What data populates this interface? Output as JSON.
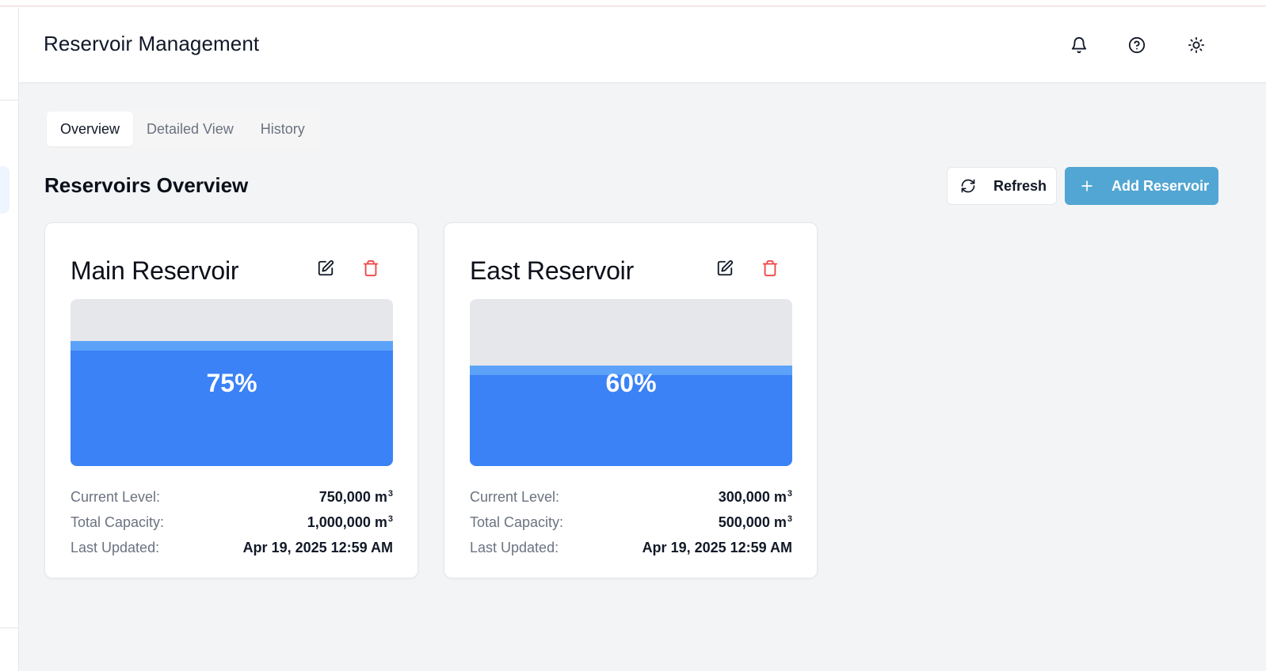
{
  "header": {
    "title": "Reservoir Management",
    "icons": [
      "bell-icon",
      "help-circle-icon",
      "sun-icon"
    ]
  },
  "tabs": [
    {
      "label": "Overview",
      "active": true
    },
    {
      "label": "Detailed View",
      "active": false
    },
    {
      "label": "History",
      "active": false
    }
  ],
  "section": {
    "title": "Reservoirs Overview",
    "refresh_label": "Refresh",
    "add_label": "Add Reservoir"
  },
  "labels": {
    "current_level": "Current Level:",
    "total_capacity": "Total Capacity:",
    "last_updated": "Last Updated:",
    "unit": "m",
    "unit_exp": "3"
  },
  "reservoirs": [
    {
      "name": "Main Reservoir",
      "fill_fraction": 0.75,
      "percent": "75%",
      "current_level": "750,000",
      "total_capacity": "1,000,000",
      "last_updated": "Apr 19, 2025 12:59 AM"
    },
    {
      "name": "East Reservoir",
      "fill_fraction": 0.6,
      "percent": "60%",
      "current_level": "300,000",
      "total_capacity": "500,000",
      "last_updated": "Apr 19, 2025 12:59 AM"
    }
  ],
  "colors": {
    "water": "#3b82f6",
    "water_surface": "#60a5fa",
    "accent_button": "#52a6d3",
    "delete": "#ef4444"
  }
}
